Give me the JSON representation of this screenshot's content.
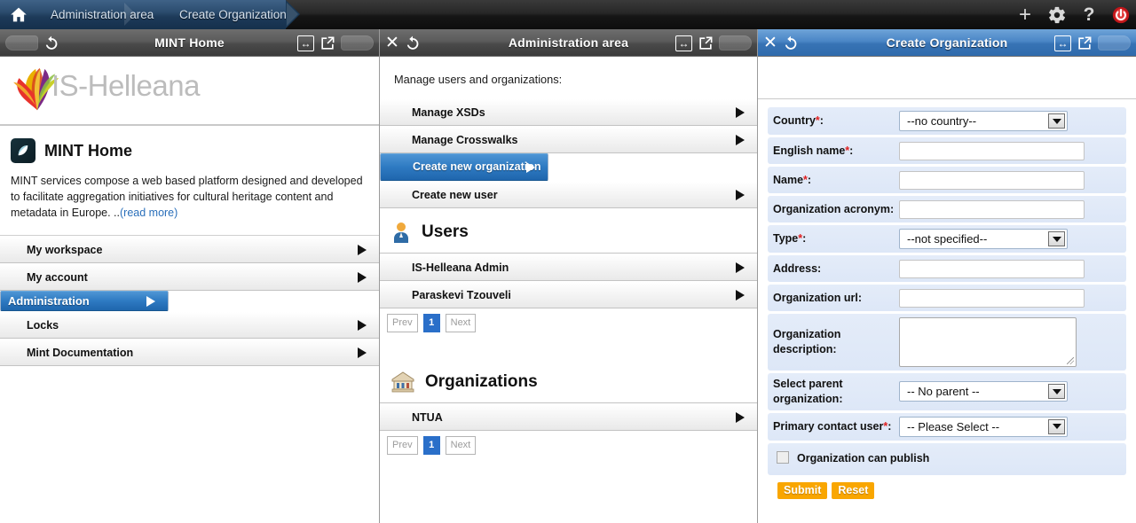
{
  "topbar": {
    "home_icon": "home-icon",
    "breadcrumbs": [
      {
        "label": "Administration area"
      },
      {
        "label": "Create Organization"
      }
    ],
    "actions": [
      {
        "name": "add-icon",
        "glyph": "+"
      },
      {
        "name": "settings-gear-icon",
        "glyph": "gear"
      },
      {
        "name": "help-icon",
        "glyph": "?"
      },
      {
        "name": "power-icon",
        "glyph": "power"
      }
    ]
  },
  "panels": {
    "left": {
      "title": "MINT Home",
      "state": "inactive",
      "logo_text": "IS-Helleana",
      "home": {
        "icon": "mint-leaf-icon",
        "title": "MINT Home",
        "description": "MINT services compose a web based platform designed and developed to facilitate aggregation initiatives for cultural heritage content and metadata in Europe. ..",
        "read_more": "(read more)"
      },
      "nav": [
        {
          "label": "My workspace",
          "selected": false
        },
        {
          "label": "My account",
          "selected": false
        },
        {
          "label": "Administration",
          "selected": true
        },
        {
          "label": "Locks",
          "selected": false
        },
        {
          "label": "Mint Documentation",
          "selected": false
        }
      ]
    },
    "mid": {
      "title": "Administration area",
      "state": "inactive",
      "section_label": "Manage users and organizations:",
      "actions": [
        {
          "label": "Manage XSDs",
          "selected": false
        },
        {
          "label": "Manage Crosswalks",
          "selected": false
        },
        {
          "label": "Create new organization",
          "selected": true
        },
        {
          "label": "Create new user",
          "selected": false
        }
      ],
      "users_group": {
        "icon": "user-icon",
        "title": "Users",
        "items": [
          {
            "label": "IS-Helleana Admin"
          },
          {
            "label": "Paraskevi Tzouveli"
          }
        ],
        "pager": {
          "prev": "Prev",
          "current": "1",
          "next": "Next"
        }
      },
      "orgs_group": {
        "icon": "organization-bank-icon",
        "title": "Organizations",
        "items": [
          {
            "label": "NTUA"
          }
        ],
        "pager": {
          "prev": "Prev",
          "current": "1",
          "next": "Next"
        }
      }
    },
    "right": {
      "title": "Create Organization",
      "state": "active",
      "form": {
        "fields": [
          {
            "label": "Country",
            "required": true,
            "control": "select",
            "value": "--no country--"
          },
          {
            "label": "English name",
            "required": true,
            "control": "text",
            "value": ""
          },
          {
            "label": "Name",
            "required": true,
            "control": "text",
            "value": ""
          },
          {
            "label": "Organization acronym",
            "required": false,
            "control": "text",
            "value": ""
          },
          {
            "label": "Type",
            "required": true,
            "control": "select",
            "value": "--not specified--"
          },
          {
            "label": "Address",
            "required": false,
            "control": "text",
            "value": ""
          },
          {
            "label": "Organization url",
            "required": false,
            "control": "text",
            "value": ""
          },
          {
            "label": "Organization description",
            "required": false,
            "control": "textarea",
            "value": ""
          },
          {
            "label": "Select parent organization",
            "required": false,
            "control": "select",
            "value": "-- No parent --"
          },
          {
            "label": "Primary contact user",
            "required": true,
            "control": "select",
            "value": "-- Please Select --"
          }
        ],
        "checkbox": {
          "label": "Organization can publish",
          "checked": false
        },
        "buttons": [
          {
            "label": "Submit",
            "name": "submit-button"
          },
          {
            "label": "Reset",
            "name": "reset-button"
          }
        ]
      }
    }
  },
  "colors": {
    "accent_blue": "#2e7ac2",
    "topbar_dark": "#1a1a1a",
    "breadcrumb_blue": "#2c4d6f",
    "submit_orange": "#f9a600",
    "required_red": "#e02020",
    "field_bg": "#e0e9f8"
  }
}
